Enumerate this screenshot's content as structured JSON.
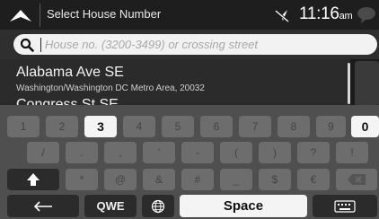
{
  "header": {
    "title": "Select House Number",
    "clock_time": "11:16",
    "clock_ampm": "am"
  },
  "search": {
    "placeholder": "House no. (3200-3499) or crossing street"
  },
  "results": [
    {
      "title": "Alabama Ave SE",
      "subtitle": "Washington/Washington DC Metro Area, 20032"
    },
    {
      "title": "Congress St SE"
    }
  ],
  "keyboard": {
    "row1": [
      "1",
      "2",
      "3",
      "4",
      "5",
      "6",
      "7",
      "8",
      "9",
      "0"
    ],
    "row1_enabled": [
      "3",
      "0"
    ],
    "row2": [
      "/",
      ".",
      ",",
      "'",
      "-",
      "(",
      ")",
      "?",
      "!"
    ],
    "row3": [
      "*",
      "@",
      "&",
      "#",
      "_",
      "$",
      "€"
    ],
    "bottom": {
      "mode_label": "QWE",
      "space_label": "Space"
    }
  },
  "icons": {
    "nav": "up-triangle-icon",
    "gps": "gps-off-icon",
    "message": "message-icon",
    "search": "search-icon",
    "shift": "shift-arrow-icon",
    "backspace": "backspace-icon",
    "back": "back-arrow-icon",
    "globe": "globe-icon",
    "hide_keyboard": "keyboard-icon"
  },
  "colors": {
    "accent_active_key": "#f4f4f4",
    "disabled_key": "#6d6d6d",
    "background": "#1b1b1b"
  }
}
